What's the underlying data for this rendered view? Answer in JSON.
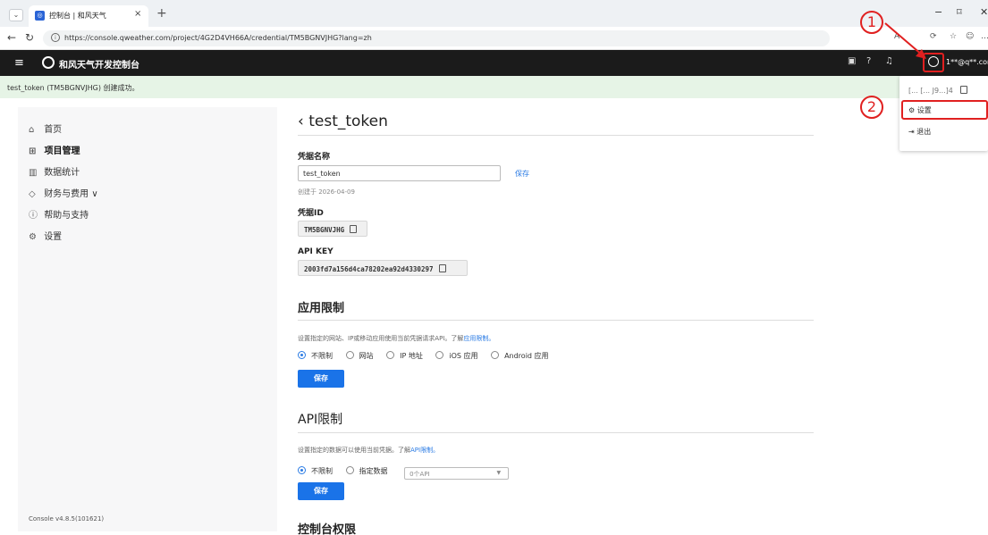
{
  "browser": {
    "tab_title": "控制台 | 和风天气",
    "tab_close": "×",
    "new_tab": "+",
    "url": "https://console.qweather.com/project/4G2D4VH66A/credential/TM5BGNVJHG?lang=zh",
    "window_controls": [
      "−",
      "⌑",
      "✕"
    ]
  },
  "header": {
    "brand": "和风天气开发控制台",
    "user_email": "1**@q**.com"
  },
  "banner": {
    "text": "test_token (TM5BGNVJHG) 创建成功。"
  },
  "sidebar": {
    "items": [
      {
        "label": "首页",
        "icon": "home-icon"
      },
      {
        "label": "项目管理",
        "icon": "grid-icon",
        "active": true
      },
      {
        "label": "数据统计",
        "icon": "chart-icon"
      },
      {
        "label": "财务与费用",
        "icon": "wallet-icon",
        "expand": "∨"
      },
      {
        "label": "帮助与支持",
        "icon": "help-icon"
      },
      {
        "label": "设置",
        "icon": "gear-icon"
      }
    ],
    "version": "Console v4.8.5(101621)"
  },
  "main": {
    "back": "‹",
    "title": "test_token",
    "name_label": "凭据名称",
    "name_value": "test_token",
    "name_save": "保存",
    "created": "创建于 2026-04-09",
    "id_label": "凭据ID",
    "id_value": "TM5BGNVJHG",
    "apikey_label": "API KEY",
    "apikey_value": "2003fd7a156d4ca78202ea92d4330297",
    "app_limit": {
      "title": "应用限制",
      "desc": "设置指定的网站、IP或移动应用使用当前凭据请求API。了解",
      "link": "应用限制。",
      "options": [
        "不限制",
        "网站",
        "IP 地址",
        "iOS 应用",
        "Android 应用"
      ],
      "selected": "不限制",
      "save": "保存"
    },
    "api_limit": {
      "title": "API限制",
      "desc": "设置指定的数据可以使用当前凭据。了解",
      "link": "API限制。",
      "options": [
        "不限制",
        "指定数据"
      ],
      "selected": "不限制",
      "select_value": "0个API",
      "save": "保存"
    },
    "console_perm": {
      "title": "控制台权限"
    }
  },
  "dropdown": {
    "masked": "[... [... J9...]4",
    "settings": "设置",
    "logout": "退出"
  },
  "annotations": {
    "step1": "1",
    "step2": "2",
    "accent": "#e02020"
  }
}
